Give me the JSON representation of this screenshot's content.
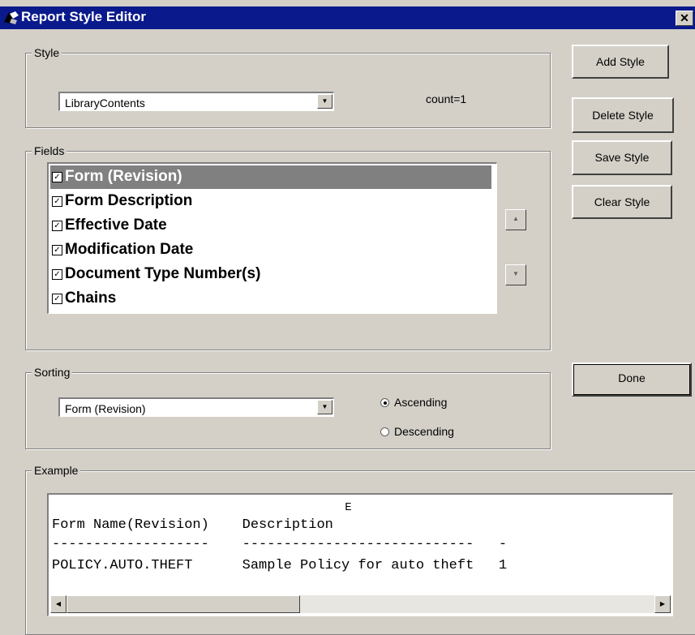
{
  "window": {
    "title": "Report Style Editor",
    "close_symbol": "✕"
  },
  "style_group": {
    "legend": "Style",
    "selected_style": "LibraryContents",
    "count_text": "count=1"
  },
  "buttons": {
    "add_style": "Add Style",
    "delete_style": "Delete Style",
    "save_style": "Save Style",
    "clear_style": "Clear Style",
    "done": "Done"
  },
  "fields_group": {
    "legend": "Fields",
    "items": [
      {
        "label": "Form (Revision)",
        "checked": true,
        "selected": true
      },
      {
        "label": "Form Description",
        "checked": true,
        "selected": false
      },
      {
        "label": "Effective Date",
        "checked": true,
        "selected": false
      },
      {
        "label": "Modification Date",
        "checked": true,
        "selected": false
      },
      {
        "label": "Document Type Number(s)",
        "checked": true,
        "selected": false
      },
      {
        "label": "Chains",
        "checked": true,
        "selected": false
      }
    ]
  },
  "sorting_group": {
    "legend": "Sorting",
    "selected_field": "Form (Revision)",
    "ascending_label": "Ascending",
    "descending_label": "Descending",
    "order": "ascending"
  },
  "example_group": {
    "legend": "Example",
    "line_0": "                                           E",
    "line_1": "Form Name(Revision)    Description",
    "line_2": "-------------------    ----------------------------   -",
    "line_3": "POLICY.AUTO.THEFT      Sample Policy for auto theft   1"
  },
  "icons": {
    "dropdown": "dropdown-arrow-icon",
    "up": "up-arrow-icon",
    "down": "down-arrow-icon",
    "scroll_left": "scroll-left-icon",
    "scroll_right": "scroll-right-icon"
  },
  "colors": {
    "titlebar": "#0a1a8c",
    "dialog": "#d4d0c8",
    "selection": "#808080"
  }
}
